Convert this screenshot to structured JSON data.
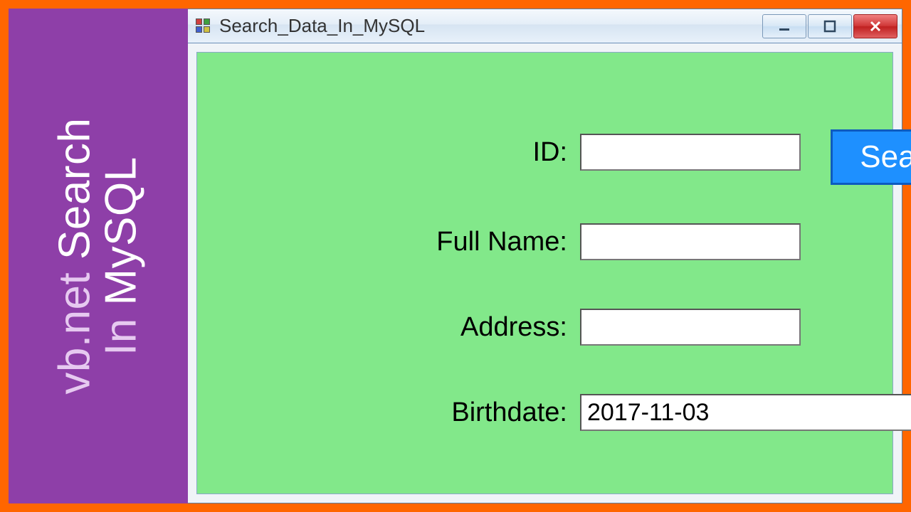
{
  "banner": {
    "line1_prefix": "vb.net",
    "line1_word": "Search",
    "line2_prefix": "In",
    "line2_word": "MySQL"
  },
  "window": {
    "title": "Search_Data_In_MySQL"
  },
  "form": {
    "labels": {
      "id": "ID:",
      "fullname": "Full Name:",
      "address": "Address:",
      "birthdate": "Birthdate:"
    },
    "values": {
      "id": "",
      "fullname": "",
      "address": "",
      "birthdate": "2017-11-03"
    },
    "search_button": "Search"
  }
}
